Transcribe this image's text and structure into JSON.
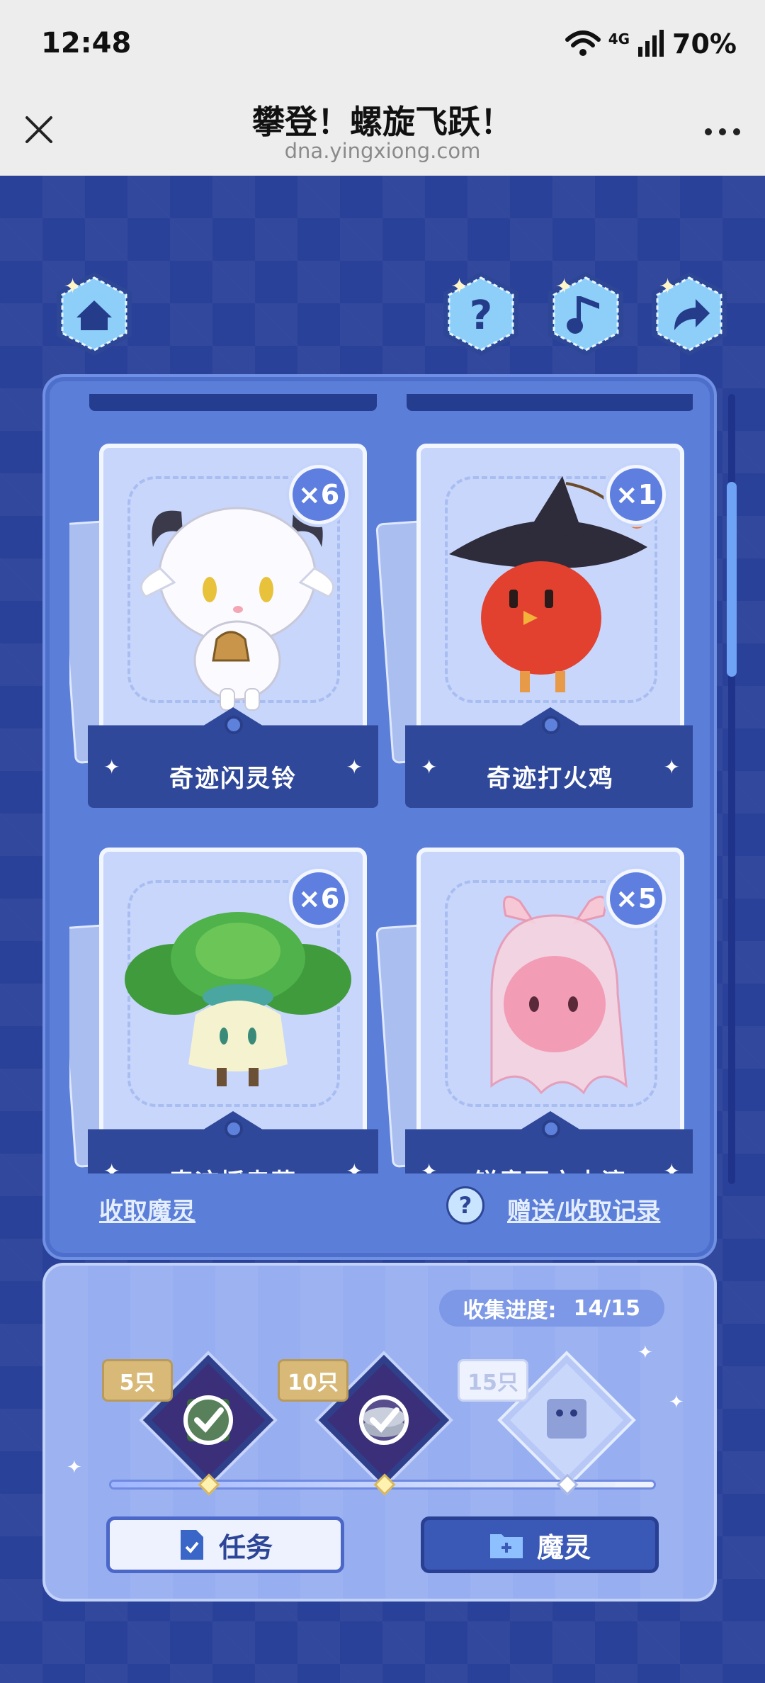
{
  "status_bar": {
    "time": "12:48",
    "network": "4G",
    "battery": "70%"
  },
  "browser": {
    "title": "攀登！螺旋飞跃！",
    "url": "dna.yingxiong.com"
  },
  "nav_icons": [
    "home-icon",
    "help-icon",
    "music-icon",
    "share-icon"
  ],
  "cards": [
    {
      "name": "奇迹闪灵铃",
      "count": "×6"
    },
    {
      "name": "奇迹打火鸡",
      "count": "×1"
    },
    {
      "name": "奇迹摇曳菇",
      "count": "×6"
    },
    {
      "name": "锐意雨衣水滴",
      "count": "×5"
    }
  ],
  "links": {
    "collect": "收取魔灵",
    "record": "赠送/收取记录"
  },
  "progress": {
    "label": "收集进度:",
    "value": "14/15",
    "milestones": [
      {
        "tag": "5只",
        "claimed": true
      },
      {
        "tag": "10只",
        "claimed": true
      },
      {
        "tag": "15只",
        "claimed": false
      }
    ]
  },
  "buttons": {
    "task": "任务",
    "spirit": "魔灵"
  },
  "colors": {
    "accent": "#2a4199",
    "panel": "#5b7ed8",
    "tag_gold": "#d9b978"
  }
}
